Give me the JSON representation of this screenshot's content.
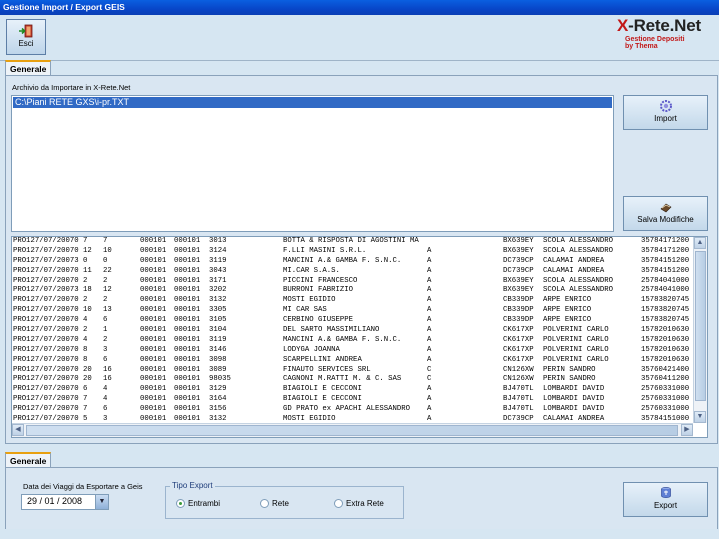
{
  "window": {
    "title": "Gestione Import / Export GEIS"
  },
  "toolbar": {
    "esci_label": "Esci"
  },
  "logo": {
    "brand": "X-Rete.Net",
    "line1": "Gestione Depositi",
    "line2": "by Thema"
  },
  "top_panel": {
    "tab": "Generale",
    "archive_label": "Archivio da Importare in X-Rete.Net",
    "archive_items": [
      "C:\\Piani RETE GXS\\i-pr.TXT"
    ],
    "import_label": "Import",
    "save_label": "Salva Modifiche"
  },
  "records": [
    [
      "PRO127/07/20070",
      "7",
      "7",
      "000101",
      "000101",
      "3013",
      "BOTTA & RISPOSTA DI AGOSTINI MA",
      "",
      "BX639EY",
      "SCOLA ALESSANDRO",
      "35784171200"
    ],
    [
      "PRO127/07/20070",
      "12",
      "10",
      "000101",
      "000101",
      "3124",
      "F.LLI MASINI S.R.L.",
      "A",
      "BX639EY",
      "SCOLA ALESSANDRO",
      "35784171200"
    ],
    [
      "PRO127/07/20073",
      "0",
      "0",
      "000101",
      "000101",
      "3119",
      "MANCINI A.& GAMBA F. S.N.C.",
      "A",
      "DC739CP",
      "CALAMAI ANDREA",
      "35784151200"
    ],
    [
      "PRO127/07/20070",
      "11",
      "22",
      "000101",
      "000101",
      "3043",
      "MI.CAR S.A.S.",
      "A",
      "DC739CP",
      "CALAMAI ANDREA",
      "35784151200"
    ],
    [
      "PRO127/07/20070",
      "2",
      "2",
      "000101",
      "000101",
      "3171",
      "PICCINI FRANCESCO",
      "A",
      "BX639EY",
      "SCOLA ALESSANDRO",
      "25784041000"
    ],
    [
      "PRO127/07/20073",
      "18",
      "12",
      "000101",
      "000101",
      "3202",
      "BURRONI FABRIZIO",
      "A",
      "BX639EY",
      "SCOLA ALESSANDRO",
      "25784041000"
    ],
    [
      "PRO127/07/20070",
      "2",
      "2",
      "000101",
      "000101",
      "3132",
      "MOSTI EGIDIO",
      "A",
      "CB339DP",
      "ARPE ENRICO",
      "15783820745"
    ],
    [
      "PRO127/07/20070",
      "10",
      "13",
      "000101",
      "000101",
      "3305",
      "MI CAR SAS",
      "A",
      "CB339DP",
      "ARPE ENRICO",
      "15783820745"
    ],
    [
      "PRO127/07/20070",
      "4",
      "6",
      "000101",
      "000101",
      "3105",
      "CERBINO GIUSEPPE",
      "A",
      "CB339DP",
      "ARPE ENRICO",
      "15783820745"
    ],
    [
      "PRO127/07/20070",
      "2",
      "1",
      "000101",
      "000101",
      "3104",
      "DEL SARTO MASSIMILIANO",
      "A",
      "CK617XP",
      "POLVERINI CARLO",
      "15782010630"
    ],
    [
      "PRO127/07/20070",
      "4",
      "2",
      "000101",
      "000101",
      "3119",
      "MANCINI A.& GAMBA F. S.N.C.",
      "A",
      "CK617XP",
      "POLVERINI CARLO",
      "15782010630"
    ],
    [
      "PRO127/07/20070",
      "8",
      "3",
      "000101",
      "000101",
      "3146",
      "LODYGA JOANNA",
      "A",
      "CK617XP",
      "POLVERINI CARLO",
      "15782010630"
    ],
    [
      "PRO127/07/20070",
      "8",
      "6",
      "000101",
      "000101",
      "3098",
      "SCARPELLINI ANDREA",
      "A",
      "CK617XP",
      "POLVERINI CARLO",
      "15782010630"
    ],
    [
      "PRO127/07/20070",
      "20",
      "16",
      "000101",
      "000101",
      "3089",
      "FINAUTO SERVICES SRL",
      "C",
      "CN126XW",
      "PERIN SANDRO",
      "35760421400"
    ],
    [
      "PRO127/07/20070",
      "20",
      "16",
      "000101",
      "000101",
      "98035",
      "CAGNONI M.RATTI M. & C. SAS",
      "C",
      "CN126XW",
      "PERIN SANDRO",
      "35760411200"
    ],
    [
      "PRO127/07/20070",
      "6",
      "4",
      "000101",
      "000101",
      "3129",
      "BIAGIOLI E CECCONI",
      "A",
      "BJ470TL",
      "LOMBARDI DAVID",
      "25760331000"
    ],
    [
      "PRO127/07/20070",
      "7",
      "4",
      "000101",
      "000101",
      "3164",
      "BIAGIOLI E CECCONI",
      "A",
      "BJ470TL",
      "LOMBARDI DAVID",
      "25760331000"
    ],
    [
      "PRO127/07/20070",
      "7",
      "6",
      "000101",
      "000101",
      "3156",
      "GD PRATO ex APACHI ALESSANDRO",
      "A",
      "BJ470TL",
      "LOMBARDI DAVID",
      "25760331000"
    ],
    [
      "PRO127/07/20070",
      "5",
      "3",
      "000101",
      "000101",
      "3132",
      "MOSTI EGIDIO",
      "A",
      "DC739CP",
      "CALAMAI ANDREA",
      "35784151000"
    ]
  ],
  "bottom_panel": {
    "tab": "Generale",
    "date_label": "Data dei Viaggi da Esportare a Geis",
    "date_value": "29 / 01 / 2008",
    "tipo_export_label": "Tipo Export",
    "options": [
      "Entrambi",
      "Rete",
      "Extra Rete"
    ],
    "selected_option": "Entrambi",
    "export_label": "Export"
  }
}
